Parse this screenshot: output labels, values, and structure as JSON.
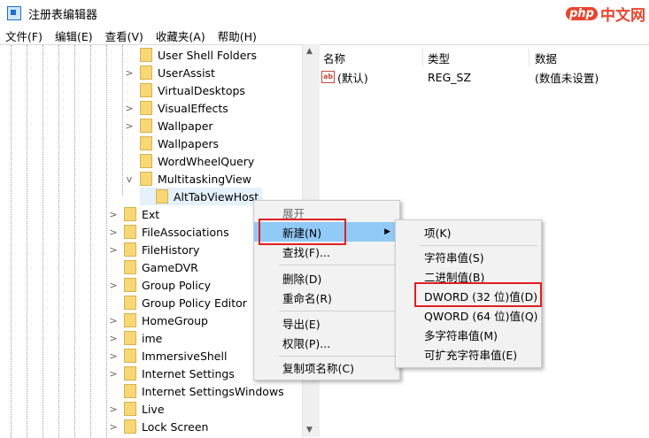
{
  "window": {
    "title": "注册表编辑器",
    "watermark_php": "php",
    "watermark_cn": "中文网"
  },
  "menubar": [
    "文件(F)",
    "编辑(E)",
    "查看(V)",
    "收藏夹(A)",
    "帮助(H)"
  ],
  "tree": {
    "nested_items": [
      {
        "label": "User Shell Folders",
        "chevron": ""
      },
      {
        "label": "UserAssist",
        "chevron": ">"
      },
      {
        "label": "VirtualDesktops",
        "chevron": ""
      },
      {
        "label": "VisualEffects",
        "chevron": ">"
      },
      {
        "label": "Wallpaper",
        "chevron": ">"
      },
      {
        "label": "Wallpapers",
        "chevron": ""
      },
      {
        "label": "WordWheelQuery",
        "chevron": ""
      },
      {
        "label": "MultitaskingView",
        "chevron": "v"
      }
    ],
    "selected_item": "AltTabViewHost",
    "items": [
      {
        "label": "Ext",
        "chevron": ">"
      },
      {
        "label": "FileAssociations",
        "chevron": ">"
      },
      {
        "label": "FileHistory",
        "chevron": ">"
      },
      {
        "label": "GameDVR",
        "chevron": ""
      },
      {
        "label": "Group Policy",
        "chevron": ">"
      },
      {
        "label": "Group Policy Editor",
        "chevron": ""
      },
      {
        "label": "HomeGroup",
        "chevron": ">"
      },
      {
        "label": "ime",
        "chevron": ">"
      },
      {
        "label": "ImmersiveShell",
        "chevron": ">"
      },
      {
        "label": "Internet Settings",
        "chevron": ">"
      },
      {
        "label": "Internet SettingsWindows",
        "chevron": ""
      },
      {
        "label": "Live",
        "chevron": ">"
      },
      {
        "label": "Lock Screen",
        "chevron": ">"
      }
    ]
  },
  "values_table": {
    "headers": {
      "name": "名称",
      "type": "类型",
      "data": "数据"
    },
    "rows": [
      {
        "icon": "ab",
        "name": "(默认)",
        "type": "REG_SZ",
        "data": "(数值未设置)"
      }
    ]
  },
  "context_menu": {
    "expand": "展开",
    "new": "新建(N)",
    "find": "查找(F)...",
    "delete": "删除(D)",
    "rename": "重命名(R)",
    "export": "导出(E)",
    "permissions": "权限(P)...",
    "copy_key_name": "复制项名称(C)"
  },
  "submenu": {
    "key": "项(K)",
    "string": "字符串值(S)",
    "binary": "二进制值(B)",
    "dword": "DWORD (32 位)值(D)",
    "qword": "QWORD (64 位)值(Q)",
    "multi_string": "多字符串值(M)",
    "expandable_string": "可扩充字符串值(E)"
  },
  "colors": {
    "highlight": "#91c9f7",
    "annotation_red": "#e02020",
    "folder": "#f8d775"
  }
}
